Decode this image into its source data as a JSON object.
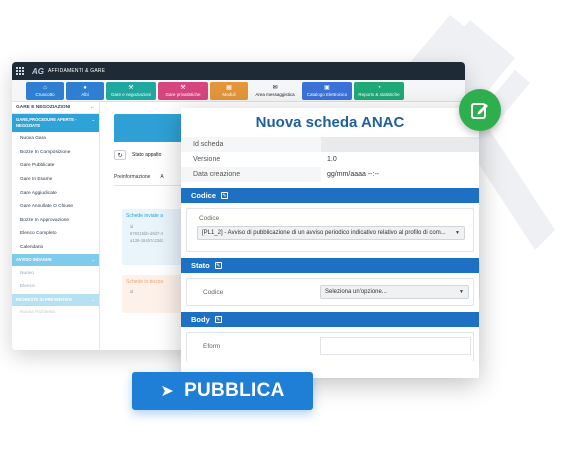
{
  "app": {
    "title": "AFFIDAMENTI & GARE",
    "logo": "AG"
  },
  "modules": [
    {
      "label": "Cruscotto",
      "color": "#2e7fd2",
      "icon": "home-icon",
      "glyph": "⌂"
    },
    {
      "label": "Albi",
      "color": "#2e7fd2",
      "icon": "users-icon",
      "glyph": "●"
    },
    {
      "label": "Gare e negoziazioni",
      "color": "#1ea8a0",
      "icon": "gavel-icon",
      "glyph": "⚒"
    },
    {
      "label": "Gare privatistiche",
      "color": "#d6467e",
      "icon": "gavel-icon",
      "glyph": "⚒"
    },
    {
      "label": "Moduli",
      "color": "#e3963a",
      "icon": "grid-icon",
      "glyph": "▦"
    },
    {
      "label": "Area messaggistica",
      "color": "transparent",
      "icon": "mail-icon",
      "glyph": "✉"
    },
    {
      "label": "Catalogo Elettronico",
      "color": "#3c72d8",
      "icon": "cart-icon",
      "glyph": "▣"
    },
    {
      "label": "Reports & statistiche",
      "color": "#1fa878",
      "icon": "chart-icon",
      "glyph": "◔"
    }
  ],
  "sidebar": {
    "header": "GARE E NEGOZIAZIONI",
    "section1": "GARE,PROCEDURE APERTE - NEGOZIATE",
    "items1": [
      "Nuova Gara",
      "Bozze In Composizione",
      "Gare Pubblicate",
      "Gare In Esame",
      "Gare Aggiudicate",
      "Gare Annullate O Chiuse",
      "Bozze In Approvazione",
      "Elenco Completo",
      "Calendario"
    ],
    "section2": "AVVISO INDAGINI",
    "items2": [
      "Nuovo",
      "Elenco"
    ],
    "section3": "RICHIESTE DI PREVENTIVO",
    "items3": [
      "Nuova Richiesta"
    ]
  },
  "main": {
    "row_label": "Stato appalto",
    "tabs": [
      "Preinformazione",
      "A"
    ],
    "card1_title": "Schede inviate a",
    "card1_lines": [
      "id",
      "878315bb-d9d7-4",
      "a138-184b7c23dc"
    ],
    "card2_title": "Schede in bozza",
    "card2_line": "id"
  },
  "modal": {
    "title": "Nuova scheda ANAC",
    "fields": [
      {
        "key": "Id scheda",
        "value": ""
      },
      {
        "key": "Versione",
        "value": "1.0"
      },
      {
        "key": "Data creazione",
        "value": "gg/mm/aaaa --:--"
      }
    ],
    "codice_section": "Codice",
    "codice_label": "Codice",
    "codice_value": "[PL1_2] - Avviso di pubblicazione di un avviso periodico indicativo relativo al profilo di com...",
    "stato_section": "Stato",
    "stato_label": "Codice",
    "stato_value": "Seleziona un'opzione...",
    "body_section": "Body",
    "body_label": "Eform"
  },
  "publish_label": "PUBBLICA",
  "colors": {
    "primary": "#1d70c2",
    "accent_green": "#2fae4e",
    "publish": "#1f7fd6"
  }
}
